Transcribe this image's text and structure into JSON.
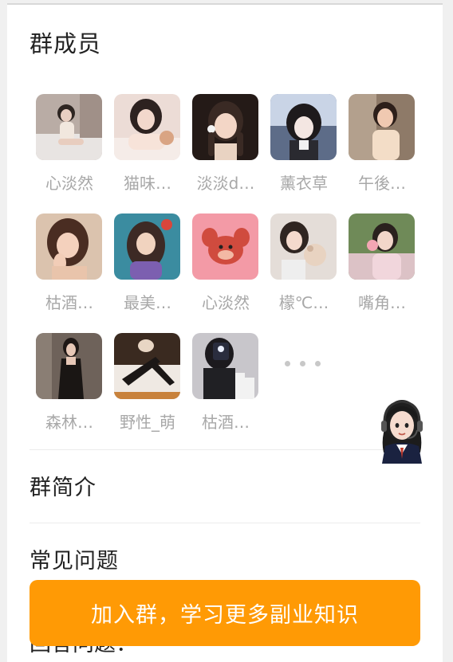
{
  "members_section": {
    "title": "群成员",
    "members": [
      {
        "name": "心淡然",
        "avatar": "photo-girl-bedroom"
      },
      {
        "name": "猫味…",
        "avatar": "photo-girl-lying"
      },
      {
        "name": "淡淡d…",
        "avatar": "photo-girl-braids"
      },
      {
        "name": "薰衣草",
        "avatar": "photo-girl-blue-light"
      },
      {
        "name": "午後…",
        "avatar": "photo-woman-smile"
      },
      {
        "name": "枯酒…",
        "avatar": "photo-girl-cheek"
      },
      {
        "name": "最美…",
        "avatar": "illustration-girl-teal"
      },
      {
        "name": "心淡然",
        "avatar": "cartoon-red-mouse"
      },
      {
        "name": "檬℃…",
        "avatar": "photo-girl-plush"
      },
      {
        "name": "嘴角…",
        "avatar": "photo-girl-flowers"
      },
      {
        "name": "森林…",
        "avatar": "photo-woman-black-dress"
      },
      {
        "name": "野性_萌",
        "avatar": "photo-legs-stockings"
      },
      {
        "name": "枯酒…",
        "avatar": "photo-mirror-selfie"
      }
    ],
    "more_icon": "ellipsis-icon"
  },
  "intro_section": {
    "title": "群简介"
  },
  "faq_section": {
    "title": "常见问题"
  },
  "partial_text": "回答问题：",
  "cta": {
    "label": "加入群，学习更多副业知识",
    "color": "#ff9a05"
  },
  "service": {
    "icon": "customer-service-avatar-icon"
  },
  "colors": {
    "background": "#f0f0f0",
    "card": "#ffffff",
    "muted_text": "#a8a8a8",
    "accent": "#ff9a05"
  }
}
